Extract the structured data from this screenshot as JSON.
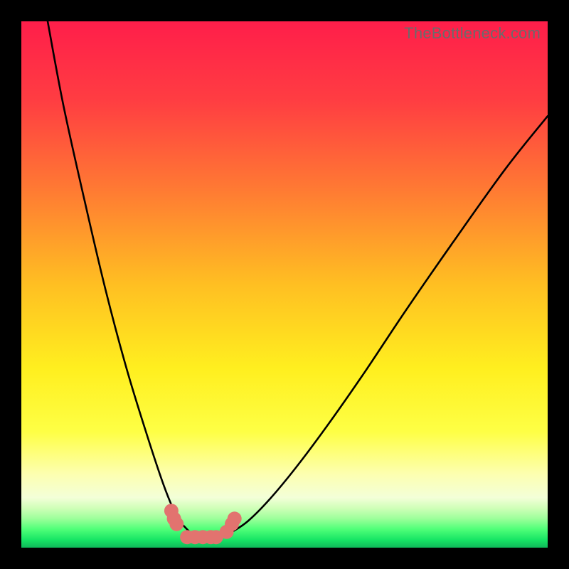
{
  "watermark": "TheBottleneck.com",
  "chart_data": {
    "type": "line",
    "title": "",
    "xlabel": "",
    "ylabel": "",
    "xlim": [
      0,
      100
    ],
    "ylim": [
      0,
      100
    ],
    "grid": false,
    "legend": false,
    "series": [
      {
        "name": "bottleneck-curve-left",
        "x": [
          5,
          8,
          12,
          16,
          20,
          24,
          27,
          29,
          30,
          31,
          32,
          33,
          34
        ],
        "y": [
          100,
          84,
          66,
          49,
          34,
          21,
          12,
          7,
          5,
          4,
          3,
          2.5,
          2
        ]
      },
      {
        "name": "bottleneck-curve-right",
        "x": [
          38,
          40,
          43,
          47,
          52,
          58,
          65,
          73,
          82,
          92,
          100
        ],
        "y": [
          2,
          3,
          5,
          9,
          15,
          23,
          33,
          45,
          58,
          72,
          82
        ]
      },
      {
        "name": "valley-points",
        "x": [
          28.5,
          29,
          29.5,
          31.5,
          33,
          34.5,
          36,
          37,
          39,
          40,
          40.5
        ],
        "y": [
          7,
          5.5,
          4.5,
          2,
          2,
          2,
          2,
          2,
          3,
          4.5,
          5.5
        ]
      }
    ],
    "gradient_stops": [
      {
        "offset": 0.0,
        "color": "#ff1e4a"
      },
      {
        "offset": 0.15,
        "color": "#ff3d42"
      },
      {
        "offset": 0.32,
        "color": "#ff7a33"
      },
      {
        "offset": 0.5,
        "color": "#ffbf22"
      },
      {
        "offset": 0.66,
        "color": "#ffef1f"
      },
      {
        "offset": 0.78,
        "color": "#feff45"
      },
      {
        "offset": 0.86,
        "color": "#fdffb0"
      },
      {
        "offset": 0.905,
        "color": "#f3ffd8"
      },
      {
        "offset": 0.925,
        "color": "#cfffb8"
      },
      {
        "offset": 0.945,
        "color": "#9cff9a"
      },
      {
        "offset": 0.965,
        "color": "#4fff78"
      },
      {
        "offset": 0.985,
        "color": "#17e565"
      },
      {
        "offset": 1.0,
        "color": "#0fb85a"
      }
    ],
    "marker_color": "#e2736f",
    "curve_color": "#000000"
  }
}
